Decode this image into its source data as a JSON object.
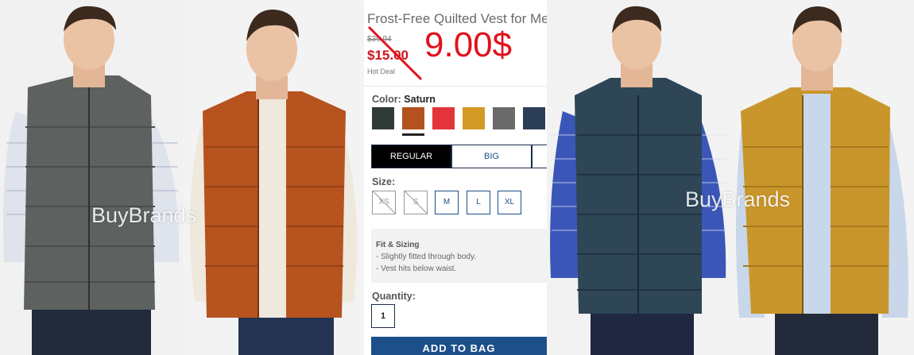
{
  "watermarks": [
    "BuyBrands",
    "BuyBrands"
  ],
  "product": {
    "title": "Frost-Free Quilted Vest for Men",
    "old_price": "$39.94",
    "sale_price": "$15.00",
    "hot_deal": "Hot Deal",
    "promo_price": "9.00$",
    "color_label": "Color:",
    "color_value": "Saturn",
    "swatches": [
      {
        "name": "dark-green",
        "color": "#2f3b34"
      },
      {
        "name": "saturn-orange",
        "color": "#b4511f"
      },
      {
        "name": "red",
        "color": "#e4343b"
      },
      {
        "name": "mustard",
        "color": "#d39a25"
      },
      {
        "name": "grey",
        "color": "#6a6a6a"
      },
      {
        "name": "navy",
        "color": "#2c3e55"
      }
    ],
    "fit_tabs": [
      "REGULAR",
      "BIG"
    ],
    "size_label": "Size:",
    "sizes": [
      {
        "label": "XS",
        "available": false
      },
      {
        "label": "S",
        "available": false
      },
      {
        "label": "M",
        "available": true
      },
      {
        "label": "L",
        "available": true
      },
      {
        "label": "XL",
        "available": true
      }
    ],
    "fit_sizing_title": "Fit & Sizing",
    "fit_sizing_lines": [
      "- Slightly fitted through body.",
      "- Vest hits below waist."
    ],
    "quantity_label": "Quantity:",
    "quantity_value": "1",
    "add_to_bag": "ADD TO BAG"
  },
  "colors": {
    "brand_blue": "#1d4f8a",
    "sale_red": "#d0111b"
  }
}
